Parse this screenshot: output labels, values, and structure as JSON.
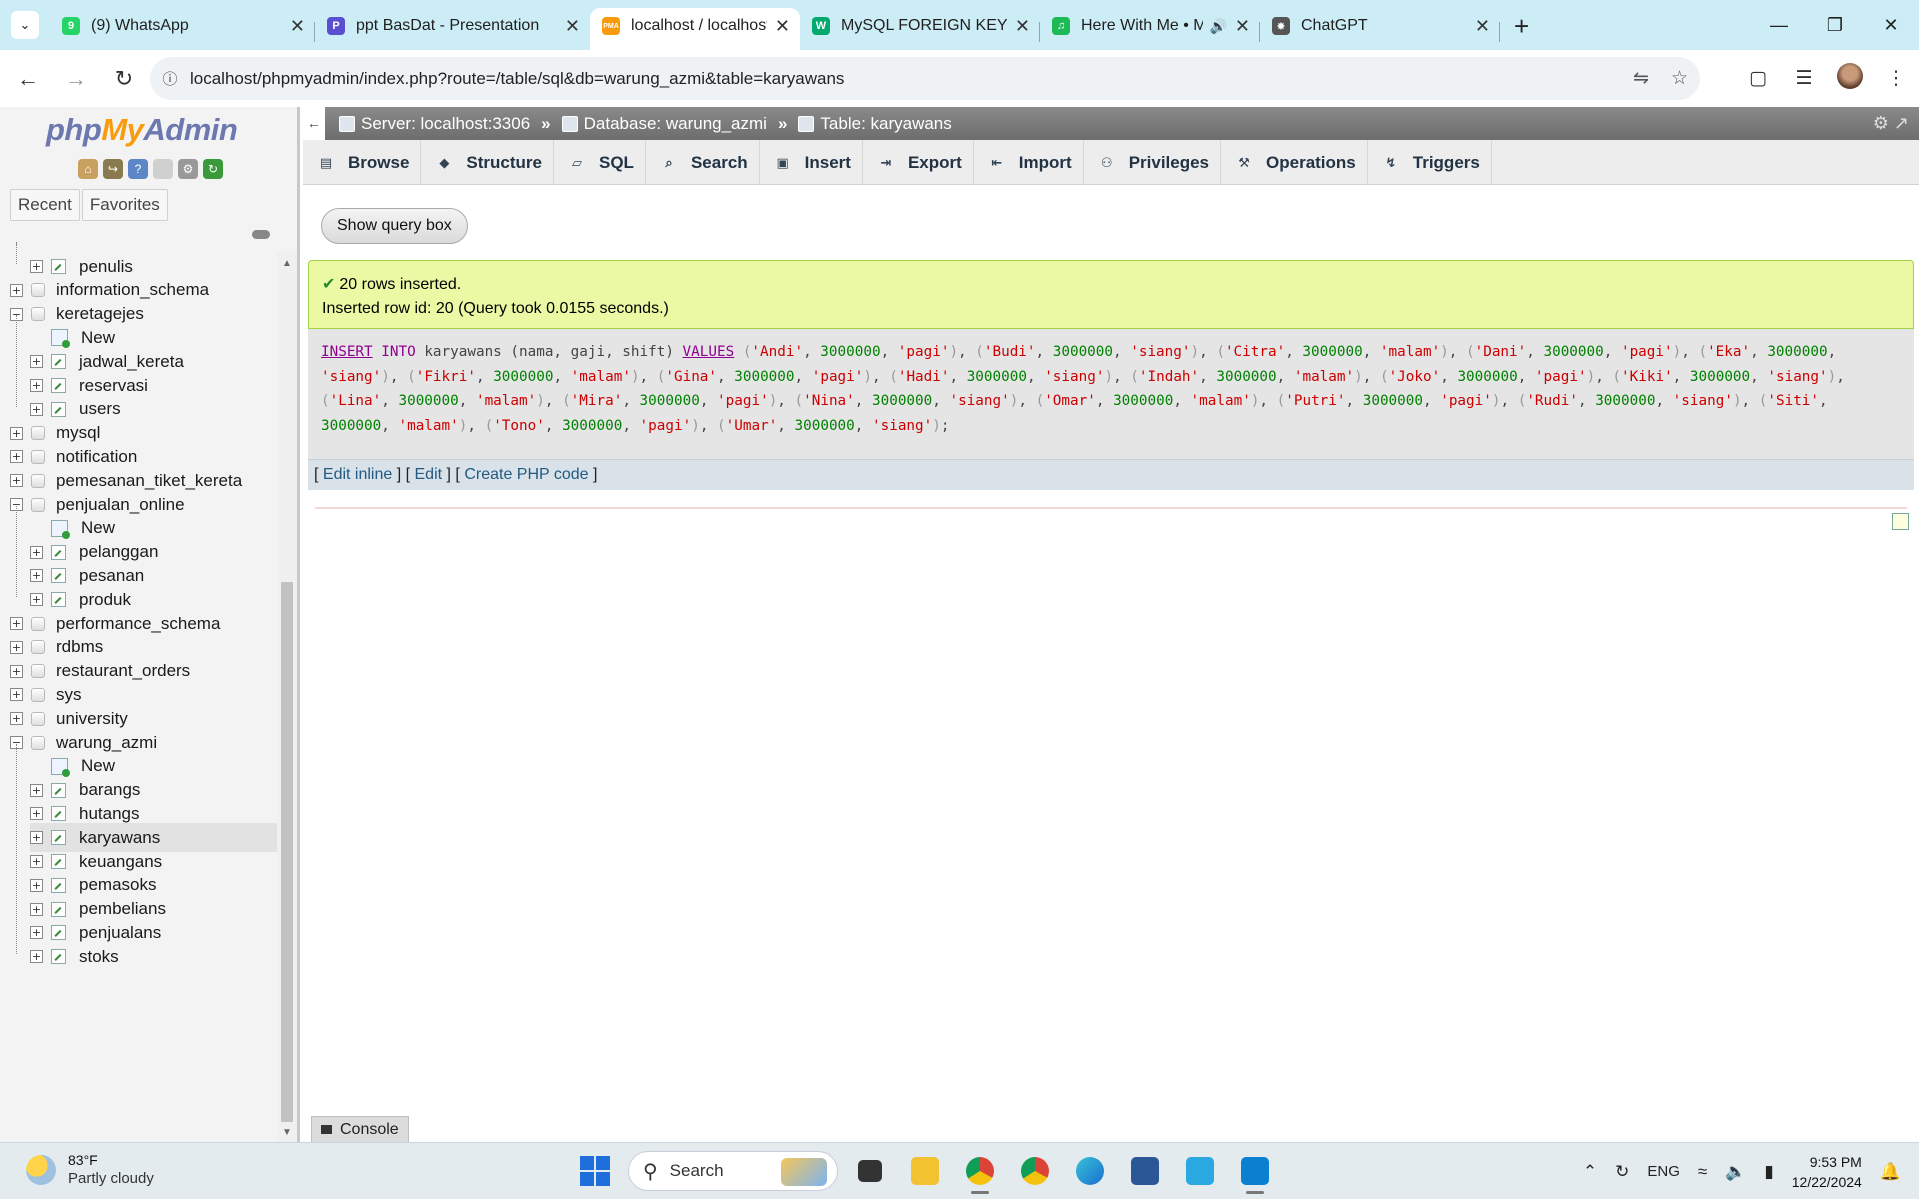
{
  "browser": {
    "tabs": [
      {
        "title": "(9) WhatsApp",
        "icon": "whatsapp-icon",
        "color": "#25d366",
        "glyph": "9"
      },
      {
        "title": "ppt BasDat - Presentation",
        "icon": "presentation-icon",
        "color": "#5b4fd1",
        "glyph": "P"
      },
      {
        "title": "localhost / localhost / waru",
        "icon": "phpmyadmin-icon",
        "color": "#f89c0e",
        "glyph": "PMA"
      },
      {
        "title": "MySQL FOREIGN KEY Cons",
        "icon": "w3schools-icon",
        "color": "#04aa6d",
        "glyph": "W"
      },
      {
        "title": "Here With Me • Marsh",
        "icon": "spotify-icon",
        "color": "#1db954",
        "glyph": "♫"
      },
      {
        "title": "ChatGPT",
        "icon": "chatgpt-icon",
        "color": "#555",
        "glyph": "✸"
      }
    ],
    "active_tab": 2,
    "url": "localhost/phpmyadmin/index.php?route=/table/sql&db=warung_azmi&table=karyawans"
  },
  "pma": {
    "logo": {
      "php": "php",
      "my": "My",
      "admin": "Admin"
    },
    "recent": "Recent",
    "favorites": "Favorites",
    "tree": [
      {
        "label": "penulis",
        "type": "table",
        "level": 1
      },
      {
        "label": "information_schema",
        "type": "db",
        "level": 0,
        "expanded": false
      },
      {
        "label": "keretagejes",
        "type": "db",
        "level": 0,
        "expanded": true
      },
      {
        "label": "New",
        "type": "new",
        "level": 1
      },
      {
        "label": "jadwal_kereta",
        "type": "table",
        "level": 1
      },
      {
        "label": "reservasi",
        "type": "table",
        "level": 1
      },
      {
        "label": "users",
        "type": "table",
        "level": 1
      },
      {
        "label": "mysql",
        "type": "db",
        "level": 0,
        "expanded": false
      },
      {
        "label": "notification",
        "type": "db",
        "level": 0,
        "expanded": false
      },
      {
        "label": "pemesanan_tiket_kereta",
        "type": "db",
        "level": 0,
        "expanded": false
      },
      {
        "label": "penjualan_online",
        "type": "db",
        "level": 0,
        "expanded": true
      },
      {
        "label": "New",
        "type": "new",
        "level": 1
      },
      {
        "label": "pelanggan",
        "type": "table",
        "level": 1
      },
      {
        "label": "pesanan",
        "type": "table",
        "level": 1
      },
      {
        "label": "produk",
        "type": "table",
        "level": 1
      },
      {
        "label": "performance_schema",
        "type": "db",
        "level": 0,
        "expanded": false
      },
      {
        "label": "rdbms",
        "type": "db",
        "level": 0,
        "expanded": false
      },
      {
        "label": "restaurant_orders",
        "type": "db",
        "level": 0,
        "expanded": false
      },
      {
        "label": "sys",
        "type": "db",
        "level": 0,
        "expanded": false
      },
      {
        "label": "university",
        "type": "db",
        "level": 0,
        "expanded": false
      },
      {
        "label": "warung_azmi",
        "type": "db",
        "level": 0,
        "expanded": true
      },
      {
        "label": "New",
        "type": "new",
        "level": 1
      },
      {
        "label": "barangs",
        "type": "table",
        "level": 1
      },
      {
        "label": "hutangs",
        "type": "table",
        "level": 1
      },
      {
        "label": "karyawans",
        "type": "table",
        "level": 1,
        "selected": true
      },
      {
        "label": "keuangans",
        "type": "table",
        "level": 1
      },
      {
        "label": "pemasoks",
        "type": "table",
        "level": 1
      },
      {
        "label": "pembelians",
        "type": "table",
        "level": 1
      },
      {
        "label": "penjualans",
        "type": "table",
        "level": 1
      },
      {
        "label": "stoks",
        "type": "table",
        "level": 1
      }
    ],
    "breadcrumb": {
      "server": "Server: localhost:3306",
      "database": "Database: warung_azmi",
      "table": "Table: karyawans"
    },
    "tabs": [
      {
        "label": "Browse",
        "icon": "browse-icon",
        "glyph": "▤"
      },
      {
        "label": "Structure",
        "icon": "structure-icon",
        "glyph": "◆"
      },
      {
        "label": "SQL",
        "icon": "sql-icon",
        "glyph": "▱"
      },
      {
        "label": "Search",
        "icon": "search-icon",
        "glyph": "⌕"
      },
      {
        "label": "Insert",
        "icon": "insert-icon",
        "glyph": "▣"
      },
      {
        "label": "Export",
        "icon": "export-icon",
        "glyph": "⇥"
      },
      {
        "label": "Import",
        "icon": "import-icon",
        "glyph": "⇤"
      },
      {
        "label": "Privileges",
        "icon": "privileges-icon",
        "glyph": "⚇"
      },
      {
        "label": "Operations",
        "icon": "operations-icon",
        "glyph": "⚒"
      },
      {
        "label": "Triggers",
        "icon": "triggers-icon",
        "glyph": "↯"
      }
    ],
    "show_query_box": "Show query box",
    "message": {
      "line1": "20 rows inserted.",
      "line2": "Inserted row id: 20 (Query took 0.0155 seconds.)"
    },
    "query": {
      "kw_insert": "INSERT",
      "kw_into": "INTO",
      "table": "karyawans",
      "columns": "(nama, gaji, shift)",
      "kw_values": "VALUES",
      "rows": [
        [
          "Andi",
          "3000000",
          "pagi"
        ],
        [
          "Budi",
          "3000000",
          "siang"
        ],
        [
          "Citra",
          "3000000",
          "malam"
        ],
        [
          "Dani",
          "3000000",
          "pagi"
        ],
        [
          "Eka",
          "3000000",
          "siang"
        ],
        [
          "Fikri",
          "3000000",
          "malam"
        ],
        [
          "Gina",
          "3000000",
          "pagi"
        ],
        [
          "Hadi",
          "3000000",
          "siang"
        ],
        [
          "Indah",
          "3000000",
          "malam"
        ],
        [
          "Joko",
          "3000000",
          "pagi"
        ],
        [
          "Kiki",
          "3000000",
          "siang"
        ],
        [
          "Lina",
          "3000000",
          "malam"
        ],
        [
          "Mira",
          "3000000",
          "pagi"
        ],
        [
          "Nina",
          "3000000",
          "siang"
        ],
        [
          "Omar",
          "3000000",
          "malam"
        ],
        [
          "Putri",
          "3000000",
          "pagi"
        ],
        [
          "Rudi",
          "3000000",
          "siang"
        ],
        [
          "Siti",
          "3000000",
          "malam"
        ],
        [
          "Tono",
          "3000000",
          "pagi"
        ],
        [
          "Umar",
          "3000000",
          "siang"
        ]
      ]
    },
    "edit_inline": "Edit inline",
    "edit": "Edit",
    "create_php": "Create PHP code",
    "console": "Console"
  },
  "taskbar": {
    "temp": "83°F",
    "weather": "Partly cloudy",
    "search": "Search",
    "lang": "ENG",
    "time": "9:53 PM",
    "date": "12/22/2024"
  }
}
